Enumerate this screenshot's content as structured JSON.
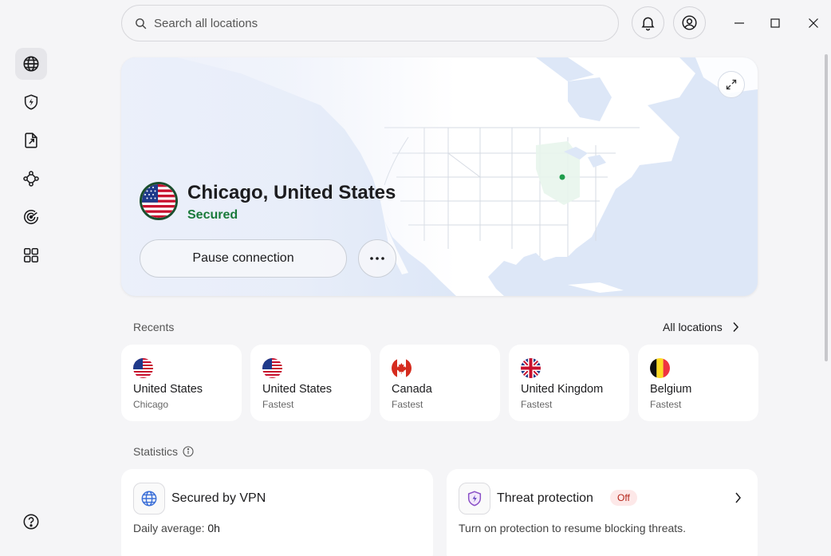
{
  "search": {
    "placeholder": "Search all locations"
  },
  "sidebar": {
    "items": [
      {
        "icon": "globe-icon",
        "active": true
      },
      {
        "icon": "shield-bolt-icon"
      },
      {
        "icon": "file-share-icon"
      },
      {
        "icon": "meshnet-icon"
      },
      {
        "icon": "radar-icon"
      },
      {
        "icon": "apps-grid-icon"
      },
      {
        "icon": "help-icon"
      }
    ]
  },
  "connection": {
    "location": "Chicago, United States",
    "status": "Secured",
    "pause_label": "Pause connection"
  },
  "recents": {
    "label": "Recents",
    "all_locations_label": "All locations",
    "items": [
      {
        "country": "United States",
        "sub": "Chicago",
        "flag": "us"
      },
      {
        "country": "United States",
        "sub": "Fastest",
        "flag": "us"
      },
      {
        "country": "Canada",
        "sub": "Fastest",
        "flag": "ca"
      },
      {
        "country": "United Kingdom",
        "sub": "Fastest",
        "flag": "gb"
      },
      {
        "country": "Belgium",
        "sub": "Fastest",
        "flag": "be"
      }
    ]
  },
  "statistics": {
    "label": "Statistics",
    "vpn": {
      "title": "Secured by VPN",
      "daily_label": "Daily average: ",
      "daily_value": "0h"
    },
    "threat": {
      "title": "Threat protection",
      "badge": "Off",
      "description": "Turn on protection to resume blocking threats."
    }
  },
  "colors": {
    "secured": "#1a7a3a",
    "map_water": "#dfe8f7",
    "map_land": "#ffffff",
    "off_badge": "#b42318"
  }
}
